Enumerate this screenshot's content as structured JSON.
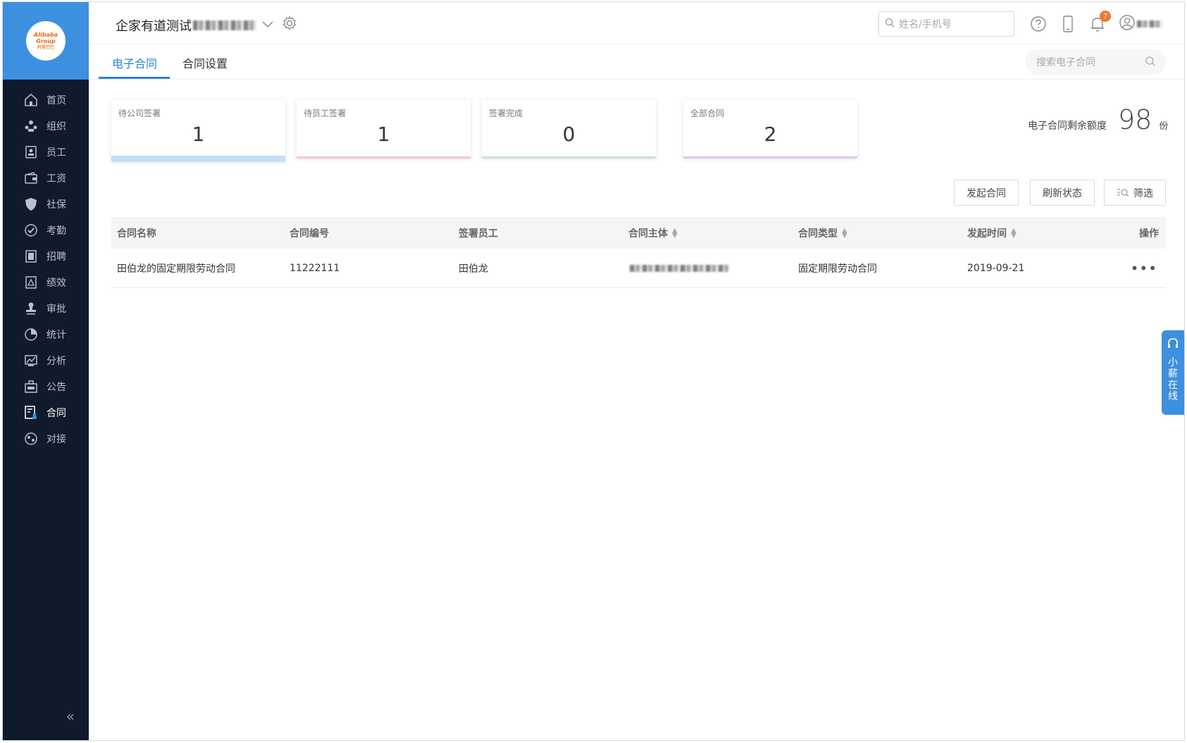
{
  "sidebar": {
    "logo_text": "Alibaba Group",
    "logo_sub": "阿里巴巴",
    "items": [
      {
        "label": "首页",
        "icon": "home-icon"
      },
      {
        "label": "组织",
        "icon": "org-icon"
      },
      {
        "label": "员工",
        "icon": "employee-icon"
      },
      {
        "label": "工资",
        "icon": "wallet-icon"
      },
      {
        "label": "社保",
        "icon": "shield-icon"
      },
      {
        "label": "考勤",
        "icon": "check-icon"
      },
      {
        "label": "招聘",
        "icon": "recruit-icon"
      },
      {
        "label": "绩效",
        "icon": "performance-icon"
      },
      {
        "label": "审批",
        "icon": "stamp-icon"
      },
      {
        "label": "统计",
        "icon": "pie-icon"
      },
      {
        "label": "分析",
        "icon": "analysis-icon"
      },
      {
        "label": "公告",
        "icon": "notice-icon"
      },
      {
        "label": "合同",
        "icon": "contract-icon"
      },
      {
        "label": "对接",
        "icon": "connect-icon"
      }
    ],
    "active_index": 12,
    "collapse_glyph": "«"
  },
  "header": {
    "company": "企家有道测试",
    "search_placeholder": "姓名/手机号",
    "notification_count": "7"
  },
  "tabs": [
    {
      "label": "电子合同"
    },
    {
      "label": "合同设置"
    }
  ],
  "contract_search_placeholder": "搜索电子合同",
  "stats": [
    {
      "label": "待公司签署",
      "value": "1",
      "color": "#bfe0f7"
    },
    {
      "label": "待员工签署",
      "value": "1",
      "color": "#f4c6d6"
    },
    {
      "label": "签署完成",
      "value": "0",
      "color": "#c8e8cf"
    },
    {
      "label": "全部合同",
      "value": "2",
      "color": "#ddc6f2"
    }
  ],
  "quota": {
    "label": "电子合同剩余额度",
    "value": "98",
    "unit": "份"
  },
  "actions": {
    "start": "发起合同",
    "refresh": "刷新状态",
    "filter": "筛选"
  },
  "table": {
    "headers": [
      "合同名称",
      "合同编号",
      "签署员工",
      "合同主体",
      "合同类型",
      "发起时间",
      "操作"
    ],
    "rows": [
      {
        "name": "田伯龙的固定期限劳动合同",
        "number": "11222111",
        "employee": "田伯龙",
        "type": "固定期限劳动合同",
        "date": "2019-09-21",
        "more": "•••"
      }
    ]
  },
  "help": {
    "label": "小薪在线"
  },
  "colors": {
    "accent": "#2b84d8",
    "sidebar_bg": "#0f1b2b",
    "sidebar_logo_bg": "#3d8fe0"
  }
}
